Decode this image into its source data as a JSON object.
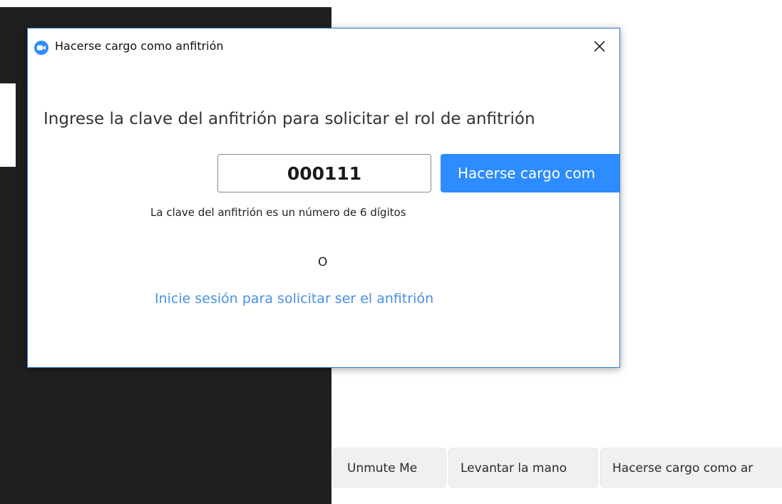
{
  "dialog": {
    "title": "Hacerse cargo como anfitrión",
    "prompt": "Ingrese la clave del anfitrión para solicitar el rol de anfitrión",
    "host_key_value": "000111",
    "claim_button_label": "Hacerse cargo com",
    "hint": "La clave del anfitrión es un número de 6 dígitos",
    "or_label": "O",
    "signin_link": "Inicie sesión para solicitar ser el anfitrión",
    "accent_color": "#2d8cff"
  },
  "bottom_bar": {
    "buttons": [
      {
        "label": "Unmute Me"
      },
      {
        "label": "Levantar la mano"
      },
      {
        "label": "Hacerse cargo como ar"
      }
    ]
  },
  "icons": {
    "app": "zoom-logo-icon",
    "close": "close-icon"
  }
}
